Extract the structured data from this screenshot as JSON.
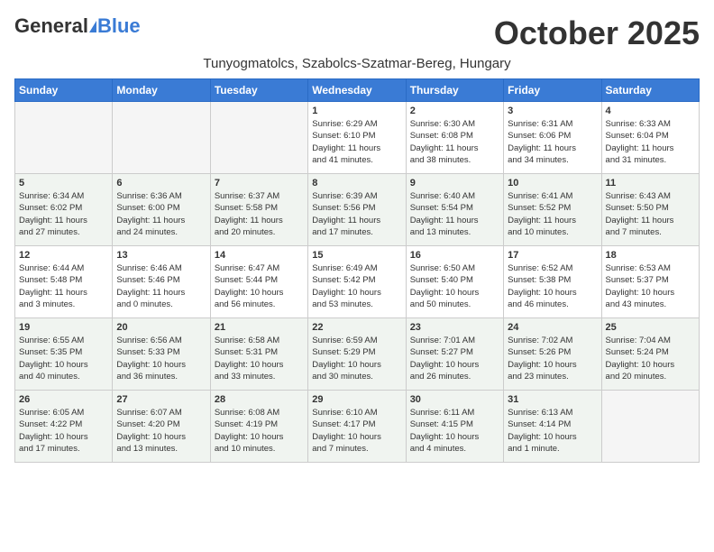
{
  "header": {
    "logo_general": "General",
    "logo_blue": "Blue",
    "month_title": "October 2025",
    "location": "Tunyogmatolcs, Szabolcs-Szatmar-Bereg, Hungary"
  },
  "days_of_week": [
    "Sunday",
    "Monday",
    "Tuesday",
    "Wednesday",
    "Thursday",
    "Friday",
    "Saturday"
  ],
  "weeks": [
    [
      {
        "day": "",
        "info": "",
        "empty": true
      },
      {
        "day": "",
        "info": "",
        "empty": true
      },
      {
        "day": "",
        "info": "",
        "empty": true
      },
      {
        "day": "1",
        "info": "Sunrise: 6:29 AM\nSunset: 6:10 PM\nDaylight: 11 hours\nand 41 minutes.",
        "empty": false
      },
      {
        "day": "2",
        "info": "Sunrise: 6:30 AM\nSunset: 6:08 PM\nDaylight: 11 hours\nand 38 minutes.",
        "empty": false
      },
      {
        "day": "3",
        "info": "Sunrise: 6:31 AM\nSunset: 6:06 PM\nDaylight: 11 hours\nand 34 minutes.",
        "empty": false
      },
      {
        "day": "4",
        "info": "Sunrise: 6:33 AM\nSunset: 6:04 PM\nDaylight: 11 hours\nand 31 minutes.",
        "empty": false
      }
    ],
    [
      {
        "day": "5",
        "info": "Sunrise: 6:34 AM\nSunset: 6:02 PM\nDaylight: 11 hours\nand 27 minutes.",
        "empty": false
      },
      {
        "day": "6",
        "info": "Sunrise: 6:36 AM\nSunset: 6:00 PM\nDaylight: 11 hours\nand 24 minutes.",
        "empty": false
      },
      {
        "day": "7",
        "info": "Sunrise: 6:37 AM\nSunset: 5:58 PM\nDaylight: 11 hours\nand 20 minutes.",
        "empty": false
      },
      {
        "day": "8",
        "info": "Sunrise: 6:39 AM\nSunset: 5:56 PM\nDaylight: 11 hours\nand 17 minutes.",
        "empty": false
      },
      {
        "day": "9",
        "info": "Sunrise: 6:40 AM\nSunset: 5:54 PM\nDaylight: 11 hours\nand 13 minutes.",
        "empty": false
      },
      {
        "day": "10",
        "info": "Sunrise: 6:41 AM\nSunset: 5:52 PM\nDaylight: 11 hours\nand 10 minutes.",
        "empty": false
      },
      {
        "day": "11",
        "info": "Sunrise: 6:43 AM\nSunset: 5:50 PM\nDaylight: 11 hours\nand 7 minutes.",
        "empty": false
      }
    ],
    [
      {
        "day": "12",
        "info": "Sunrise: 6:44 AM\nSunset: 5:48 PM\nDaylight: 11 hours\nand 3 minutes.",
        "empty": false
      },
      {
        "day": "13",
        "info": "Sunrise: 6:46 AM\nSunset: 5:46 PM\nDaylight: 11 hours\nand 0 minutes.",
        "empty": false
      },
      {
        "day": "14",
        "info": "Sunrise: 6:47 AM\nSunset: 5:44 PM\nDaylight: 10 hours\nand 56 minutes.",
        "empty": false
      },
      {
        "day": "15",
        "info": "Sunrise: 6:49 AM\nSunset: 5:42 PM\nDaylight: 10 hours\nand 53 minutes.",
        "empty": false
      },
      {
        "day": "16",
        "info": "Sunrise: 6:50 AM\nSunset: 5:40 PM\nDaylight: 10 hours\nand 50 minutes.",
        "empty": false
      },
      {
        "day": "17",
        "info": "Sunrise: 6:52 AM\nSunset: 5:38 PM\nDaylight: 10 hours\nand 46 minutes.",
        "empty": false
      },
      {
        "day": "18",
        "info": "Sunrise: 6:53 AM\nSunset: 5:37 PM\nDaylight: 10 hours\nand 43 minutes.",
        "empty": false
      }
    ],
    [
      {
        "day": "19",
        "info": "Sunrise: 6:55 AM\nSunset: 5:35 PM\nDaylight: 10 hours\nand 40 minutes.",
        "empty": false
      },
      {
        "day": "20",
        "info": "Sunrise: 6:56 AM\nSunset: 5:33 PM\nDaylight: 10 hours\nand 36 minutes.",
        "empty": false
      },
      {
        "day": "21",
        "info": "Sunrise: 6:58 AM\nSunset: 5:31 PM\nDaylight: 10 hours\nand 33 minutes.",
        "empty": false
      },
      {
        "day": "22",
        "info": "Sunrise: 6:59 AM\nSunset: 5:29 PM\nDaylight: 10 hours\nand 30 minutes.",
        "empty": false
      },
      {
        "day": "23",
        "info": "Sunrise: 7:01 AM\nSunset: 5:27 PM\nDaylight: 10 hours\nand 26 minutes.",
        "empty": false
      },
      {
        "day": "24",
        "info": "Sunrise: 7:02 AM\nSunset: 5:26 PM\nDaylight: 10 hours\nand 23 minutes.",
        "empty": false
      },
      {
        "day": "25",
        "info": "Sunrise: 7:04 AM\nSunset: 5:24 PM\nDaylight: 10 hours\nand 20 minutes.",
        "empty": false
      }
    ],
    [
      {
        "day": "26",
        "info": "Sunrise: 6:05 AM\nSunset: 4:22 PM\nDaylight: 10 hours\nand 17 minutes.",
        "empty": false
      },
      {
        "day": "27",
        "info": "Sunrise: 6:07 AM\nSunset: 4:20 PM\nDaylight: 10 hours\nand 13 minutes.",
        "empty": false
      },
      {
        "day": "28",
        "info": "Sunrise: 6:08 AM\nSunset: 4:19 PM\nDaylight: 10 hours\nand 10 minutes.",
        "empty": false
      },
      {
        "day": "29",
        "info": "Sunrise: 6:10 AM\nSunset: 4:17 PM\nDaylight: 10 hours\nand 7 minutes.",
        "empty": false
      },
      {
        "day": "30",
        "info": "Sunrise: 6:11 AM\nSunset: 4:15 PM\nDaylight: 10 hours\nand 4 minutes.",
        "empty": false
      },
      {
        "day": "31",
        "info": "Sunrise: 6:13 AM\nSunset: 4:14 PM\nDaylight: 10 hours\nand 1 minute.",
        "empty": false
      },
      {
        "day": "",
        "info": "",
        "empty": true
      }
    ]
  ]
}
